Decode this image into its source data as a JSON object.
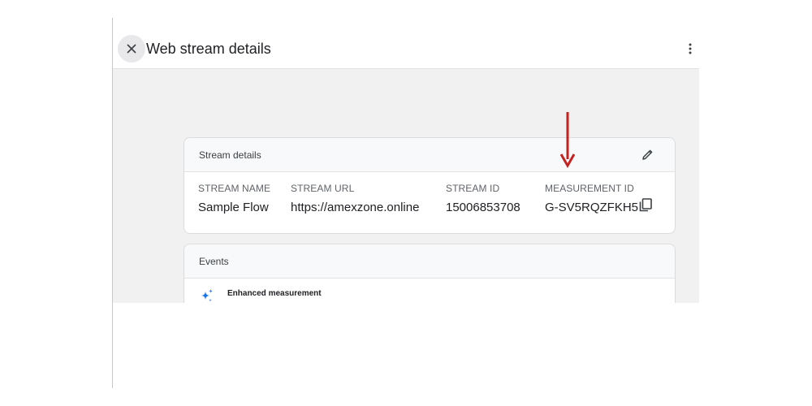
{
  "header": {
    "title": "Web stream details",
    "close_icon": "close-icon",
    "more_icon": "more-vert-icon"
  },
  "stream_card": {
    "title": "Stream details",
    "edit_icon": "edit-pencil-icon",
    "fields": [
      {
        "label": "STREAM NAME",
        "value": "Sample Flow"
      },
      {
        "label": "STREAM URL",
        "value": "https://amexzone.online"
      },
      {
        "label": "STREAM ID",
        "value": "15006853708"
      },
      {
        "label": "MEASUREMENT ID",
        "value": "G-SV5RQZFKH5"
      }
    ],
    "copy_icon": "copy-icon"
  },
  "events_card": {
    "title": "Events",
    "items": [
      {
        "label": "Enhanced measurement",
        "icon": "sparkle-icon"
      }
    ]
  },
  "annotation": {
    "icon": "red-down-arrow",
    "color": "#c5221f"
  },
  "colors": {
    "content_bg": "#f1f1f2",
    "card_border": "#dcdcdc",
    "sparkle_blue": "#4285f4"
  }
}
